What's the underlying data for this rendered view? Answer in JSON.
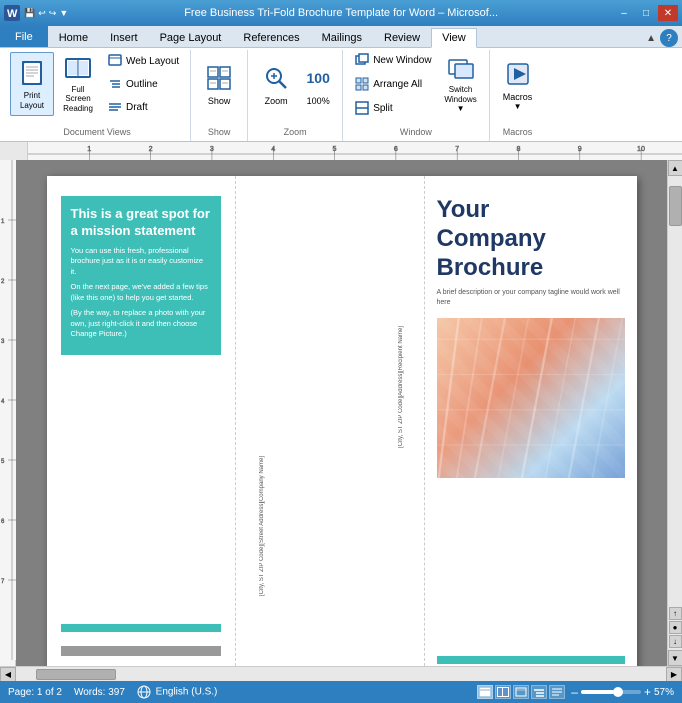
{
  "titleBar": {
    "title": "Free Business Tri-Fold Brochure Template for Word – Microsof...",
    "minBtn": "–",
    "maxBtn": "□",
    "closeBtn": "✕",
    "icon": "W"
  },
  "ribbonTabs": {
    "tabs": [
      "File",
      "Home",
      "Insert",
      "Page Layout",
      "References",
      "Mailings",
      "Review",
      "View"
    ],
    "activeTab": "View",
    "helpIcon": "?"
  },
  "ribbon": {
    "groups": [
      {
        "name": "Document Views",
        "label": "Document Views",
        "buttons": [
          {
            "id": "print-layout",
            "label": "Print\nLayout",
            "icon": "📄"
          },
          {
            "id": "full-screen-reading",
            "label": "Full Screen\nReading",
            "icon": "📖"
          }
        ],
        "smallButtons": [
          {
            "id": "web-layout",
            "label": "Web Layout",
            "icon": "🌐"
          },
          {
            "id": "outline",
            "label": "Outline",
            "icon": "≡"
          },
          {
            "id": "draft",
            "label": "Draft",
            "icon": "📝"
          }
        ]
      },
      {
        "name": "Show",
        "label": "Show",
        "buttons": [
          {
            "id": "show",
            "label": "Show",
            "icon": "☑"
          }
        ]
      },
      {
        "name": "Zoom",
        "label": "Zoom",
        "buttons": [
          {
            "id": "zoom",
            "label": "Zoom",
            "icon": "🔍"
          }
        ],
        "zoomValue": "100%"
      },
      {
        "name": "Window",
        "label": "Window",
        "buttons": [
          {
            "id": "new-window",
            "label": "New Window",
            "icon": "⊞"
          },
          {
            "id": "arrange-all",
            "label": "Arrange All",
            "icon": "⊟"
          },
          {
            "id": "split",
            "label": "Split",
            "icon": "⊠"
          },
          {
            "id": "switch-windows",
            "label": "Switch\nWindows",
            "icon": "⇌"
          }
        ]
      },
      {
        "name": "Macros",
        "label": "Macros",
        "buttons": [
          {
            "id": "macros",
            "label": "Macros",
            "icon": "▶"
          }
        ]
      }
    ]
  },
  "brochure": {
    "leftPanel": {
      "tealBoxTitle": "This is a great spot for a mission statement",
      "para1": "You can use this fresh, professional brochure just as it is or easily customize it.",
      "para2": "On the next page, we've added a few tips (like this one) to help you get started.",
      "para3": "(By the way, to replace a photo with your own, just right-click it and then choose Change Picture.)"
    },
    "midPanel": {
      "verticalText1Line1": "[Recipient Name]",
      "verticalText1Line2": "[Address]",
      "verticalText1Line3": "[City, ST  ZIP Code]",
      "verticalText2Line1": "[Company Name]",
      "verticalText2Line2": "[Street Address]",
      "verticalText2Line3": "[City, ST  ZIP Code]"
    },
    "rightPanel": {
      "title": "Your\nCompany\nBrochure",
      "subtitle": "A brief description or your company tagline would work well here"
    }
  },
  "statusBar": {
    "page": "Page: 1 of 2",
    "words": "Words: 397",
    "language": "English (U.S.)",
    "zoom": "57%",
    "zoomMinus": "–",
    "zoomPlus": "+"
  }
}
